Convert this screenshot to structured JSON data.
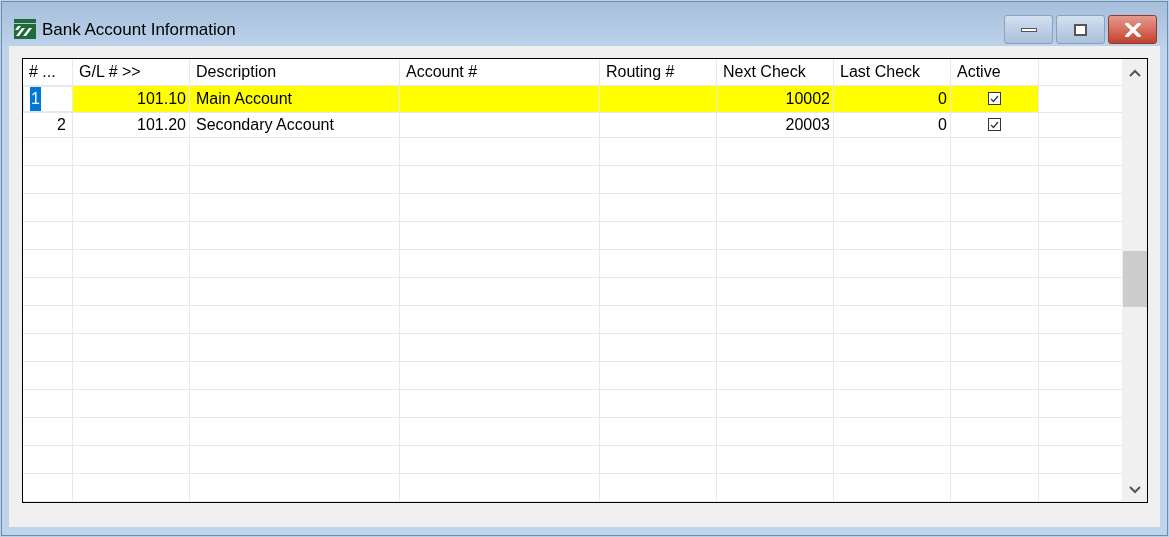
{
  "window": {
    "title": "Bank Account Information"
  },
  "table": {
    "columns": [
      "# ...",
      "G/L # >>",
      "Description",
      "Account #",
      "Routing #",
      "Next Check",
      "Last Check",
      "Active"
    ],
    "rows": [
      {
        "number": "1",
        "gl": "101.10",
        "description": "Main Account",
        "next_check": "10002",
        "last_check": "0",
        "active": true,
        "selected": true
      },
      {
        "number": "2",
        "gl": "101.20",
        "description": "Secondary Account",
        "next_check": "20003",
        "last_check": "0",
        "active": true,
        "selected": false
      }
    ]
  }
}
